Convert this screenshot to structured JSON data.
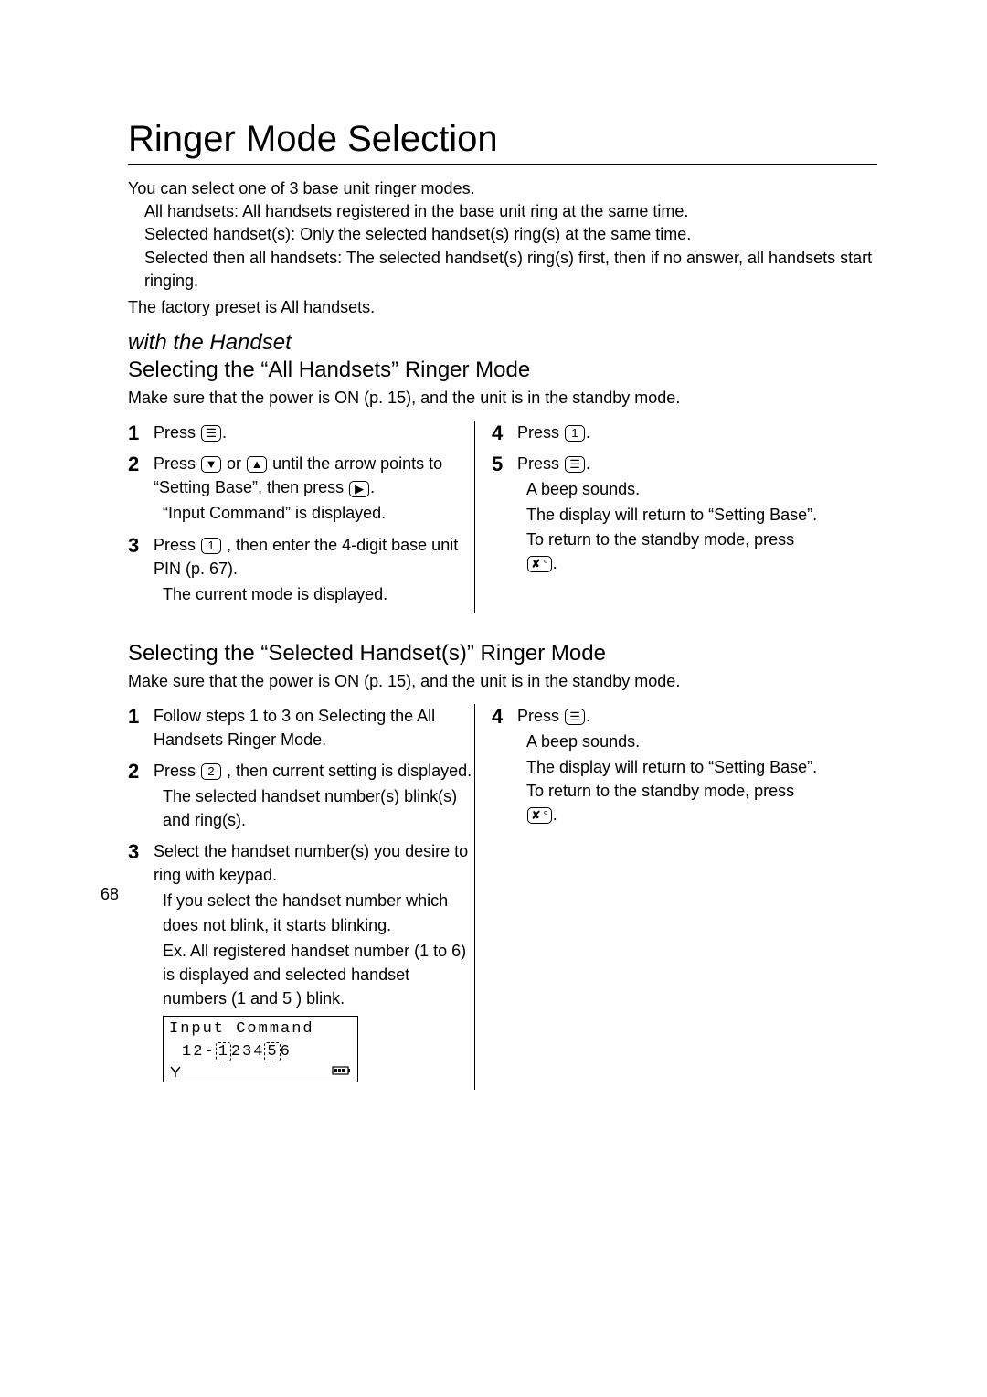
{
  "page_title": "Ringer Mode Selection",
  "intro_line": "You can select one of 3 base unit ringer modes.",
  "modes": [
    {
      "label": "All handsets:",
      "desc": " All handsets registered in the base unit ring at the same time."
    },
    {
      "label": "Selected handset(s):",
      "desc": " Only the selected handset(s) ring(s) at the same time."
    },
    {
      "label": "Selected then all handsets:",
      "desc": " The selected handset(s) ring(s) first, then if no answer, all handsets start ringing."
    }
  ],
  "factory_preset": "The factory preset is All handsets.",
  "sec1_sub1": "with the Handset",
  "sec1_sub2": "Selecting the “All Handsets” Ringer Mode",
  "precond": "Make sure that the power is ON (p. 15), and the unit is in the standby mode.",
  "s1": {
    "n1": "1",
    "t1": "Press ",
    "n2": "2",
    "t2a": "Press ",
    "t2b": " or ",
    "t2c": " until the arrow points to “Setting Base”, then press ",
    "t2d": "“Input Command” is displayed.",
    "n3": "3",
    "t3": ", then enter the 4-digit base unit PIN (p. 67).",
    "t3b": "The current mode is displayed.",
    "n4": "4",
    "t4": "Press ",
    "n5": "5",
    "t5": "Press ",
    "beep": "A beep sounds.",
    "ret1": "The display will return to “Setting Base”. To return to the standby mode, press "
  },
  "sec2_sub2": "Selecting the “Selected Handset(s)” Ringer Mode",
  "s2": {
    "n1": "1",
    "t1": "Follow steps 1 to 3 on Selecting the All Handsets Ringer Mode.",
    "n2": "2",
    "t2a": "Press ",
    "t2b": ", then current setting is displayed.",
    "t2c": "The selected handset number(s) blink(s) and ring(s).",
    "n3": "3",
    "t3": "Select the handset number(s) you desire to ring with keypad.",
    "t3b": "If you select the handset number which does not blink, it starts blinking.",
    "t3c": "Ex. All registered handset number (1 to 6) is displayed and selected handset numbers (1 and 5 ) blink.",
    "n4": "4",
    "t4": "Press ",
    "beep": "A beep sounds.",
    "ret1": "The display will return to “Setting Base”. To return to the standby mode, press "
  },
  "keys": {
    "menu": "☰",
    "down": "▼",
    "up": "▲",
    "right": "▶",
    "k1": "1",
    "k2": "2",
    "end": "✘ °"
  },
  "lcd": {
    "line1": "Input Command",
    "line2_pre": "12-",
    "line2_nums_a": "1",
    "line2_nums_mid": "234",
    "line2_nums_b": "5",
    "line2_nums_end": "6"
  },
  "page_number": "68"
}
